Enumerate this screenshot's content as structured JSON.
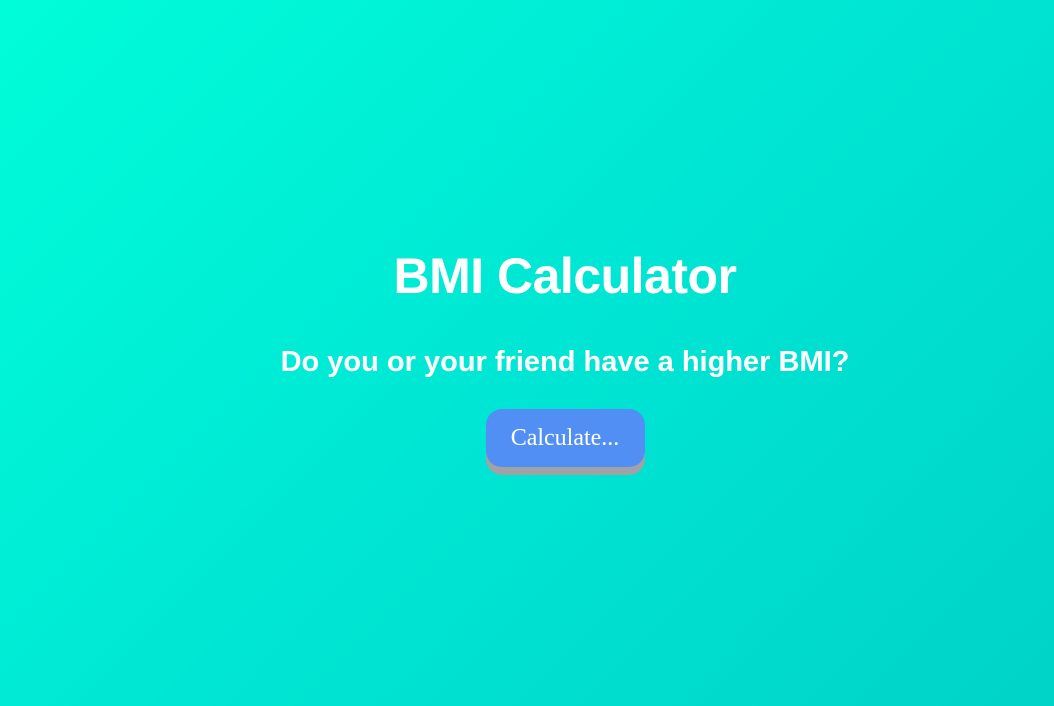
{
  "hero": {
    "title": "BMI Calculator",
    "subtitle": "Do you or your friend have a higher BMI?",
    "button_label": "Calculate..."
  },
  "colors": {
    "background_start": "#00fdd9",
    "background_end": "#00d3c8",
    "button": "#528ff5",
    "button_shadow": "#a0a3a6",
    "text": "#ffffff"
  }
}
